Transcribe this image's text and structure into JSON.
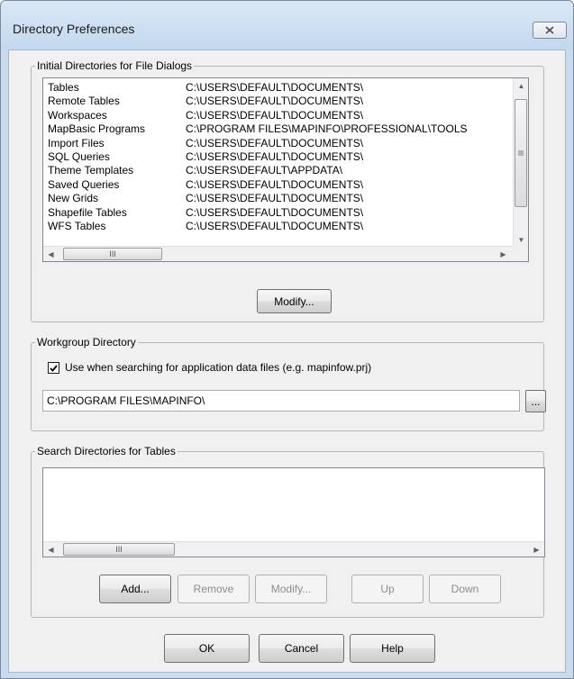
{
  "window": {
    "title": "Directory Preferences"
  },
  "initial_dirs": {
    "legend": "Initial Directories for File Dialogs",
    "rows": [
      {
        "name": "Tables",
        "path": "C:\\USERS\\DEFAULT\\DOCUMENTS\\"
      },
      {
        "name": "Remote Tables",
        "path": "C:\\USERS\\DEFAULT\\DOCUMENTS\\"
      },
      {
        "name": "Workspaces",
        "path": "C:\\USERS\\DEFAULT\\DOCUMENTS\\"
      },
      {
        "name": "MapBasic Programs",
        "path": "C:\\PROGRAM FILES\\MAPINFO\\PROFESSIONAL\\TOOLS"
      },
      {
        "name": "Import Files",
        "path": "C:\\USERS\\DEFAULT\\DOCUMENTS\\"
      },
      {
        "name": "SQL Queries",
        "path": "C:\\USERS\\DEFAULT\\DOCUMENTS\\"
      },
      {
        "name": "Theme Templates",
        "path": "C:\\USERS\\DEFAULT\\APPDATA\\"
      },
      {
        "name": "Saved Queries",
        "path": "C:\\USERS\\DEFAULT\\DOCUMENTS\\"
      },
      {
        "name": "New Grids",
        "path": "C:\\USERS\\DEFAULT\\DOCUMENTS\\"
      },
      {
        "name": "Shapefile Tables",
        "path": "C:\\USERS\\DEFAULT\\DOCUMENTS\\"
      },
      {
        "name": "WFS Tables",
        "path": "C:\\USERS\\DEFAULT\\DOCUMENTS\\"
      }
    ],
    "modify_label": "Modify...",
    "scroll_grip": "III"
  },
  "workgroup": {
    "legend": "Workgroup Directory",
    "checkbox_label": "Use when searching for application data files (e.g. mapinfow.prj)",
    "checkbox_checked": true,
    "path_value": "C:\\PROGRAM FILES\\MAPINFO\\",
    "browse_label": "..."
  },
  "search_dirs": {
    "legend": "Search Directories for Tables",
    "scroll_grip": "III",
    "buttons": {
      "add": "Add...",
      "remove": "Remove",
      "modify": "Modify...",
      "up": "Up",
      "down": "Down"
    }
  },
  "footer": {
    "ok": "OK",
    "cancel": "Cancel",
    "help": "Help"
  }
}
